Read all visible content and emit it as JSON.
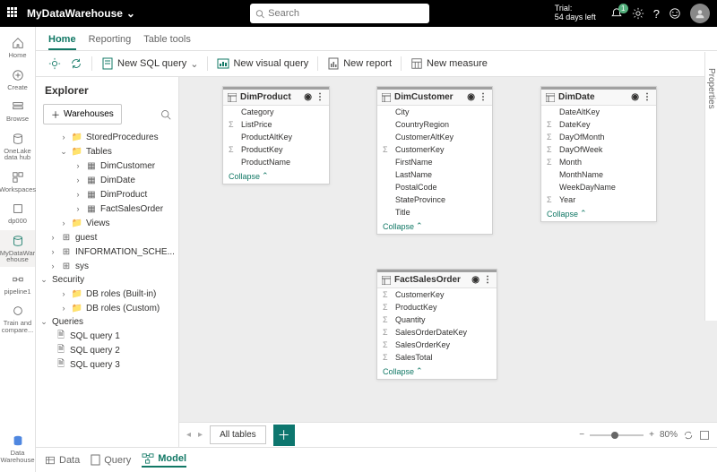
{
  "top": {
    "workspace": "MyDataWarehouse",
    "search_ph": "Search",
    "trial_l1": "Trial:",
    "trial_l2": "54 days left",
    "badge": "1"
  },
  "tabs": {
    "home": "Home",
    "reporting": "Reporting",
    "tools": "Table tools"
  },
  "toolbar": {
    "newsql": "New SQL query",
    "newvis": "New visual query",
    "newrep": "New report",
    "newmeas": "New measure"
  },
  "leftnav": {
    "home": "Home",
    "create": "Create",
    "browse": "Browse",
    "onelake": "OneLake data hub",
    "workspaces": "Workspaces",
    "dp": "dp000",
    "wh": "MyDataWar ehouse",
    "pipe": "pipeline1",
    "train": "Train and compare...",
    "bottom": "Data Warehouse"
  },
  "explorer": {
    "title": "Explorer",
    "wh_btn": "Warehouses",
    "stored": "StoredProcedures",
    "tables": "Tables",
    "t1": "DimCustomer",
    "t2": "DimDate",
    "t3": "DimProduct",
    "t4": "FactSalesOrder",
    "views": "Views",
    "guest": "guest",
    "info": "INFORMATION_SCHE...",
    "sys": "sys",
    "security": "Security",
    "roles1": "DB roles (Built-in)",
    "roles2": "DB roles (Custom)",
    "queries": "Queries",
    "q1": "SQL query 1",
    "q2": "SQL query 2",
    "q3": "SQL query 3"
  },
  "cards": {
    "dimproduct": {
      "title": "DimProduct",
      "fields": [
        "Category",
        "ListPrice",
        "ProductAltKey",
        "ProductKey",
        "ProductName"
      ]
    },
    "dimcustomer": {
      "title": "DimCustomer",
      "fields": [
        "City",
        "CountryRegion",
        "CustomerAltKey",
        "CustomerKey",
        "FirstName",
        "LastName",
        "PostalCode",
        "StateProvince",
        "Title"
      ]
    },
    "dimdate": {
      "title": "DimDate",
      "fields": [
        "DateAltKey",
        "DateKey",
        "DayOfMonth",
        "DayOfWeek",
        "Month",
        "MonthName",
        "WeekDayName",
        "Year"
      ]
    },
    "fact": {
      "title": "FactSalesOrder",
      "fields": [
        "CustomerKey",
        "ProductKey",
        "Quantity",
        "SalesOrderDateKey",
        "SalesOrderKey",
        "SalesTotal"
      ]
    },
    "collapse": "Collapse"
  },
  "footer": {
    "alltables": "All tables",
    "zoom": "80%"
  },
  "btabs": {
    "data": "Data",
    "query": "Query",
    "model": "Model"
  },
  "props": "Properties"
}
